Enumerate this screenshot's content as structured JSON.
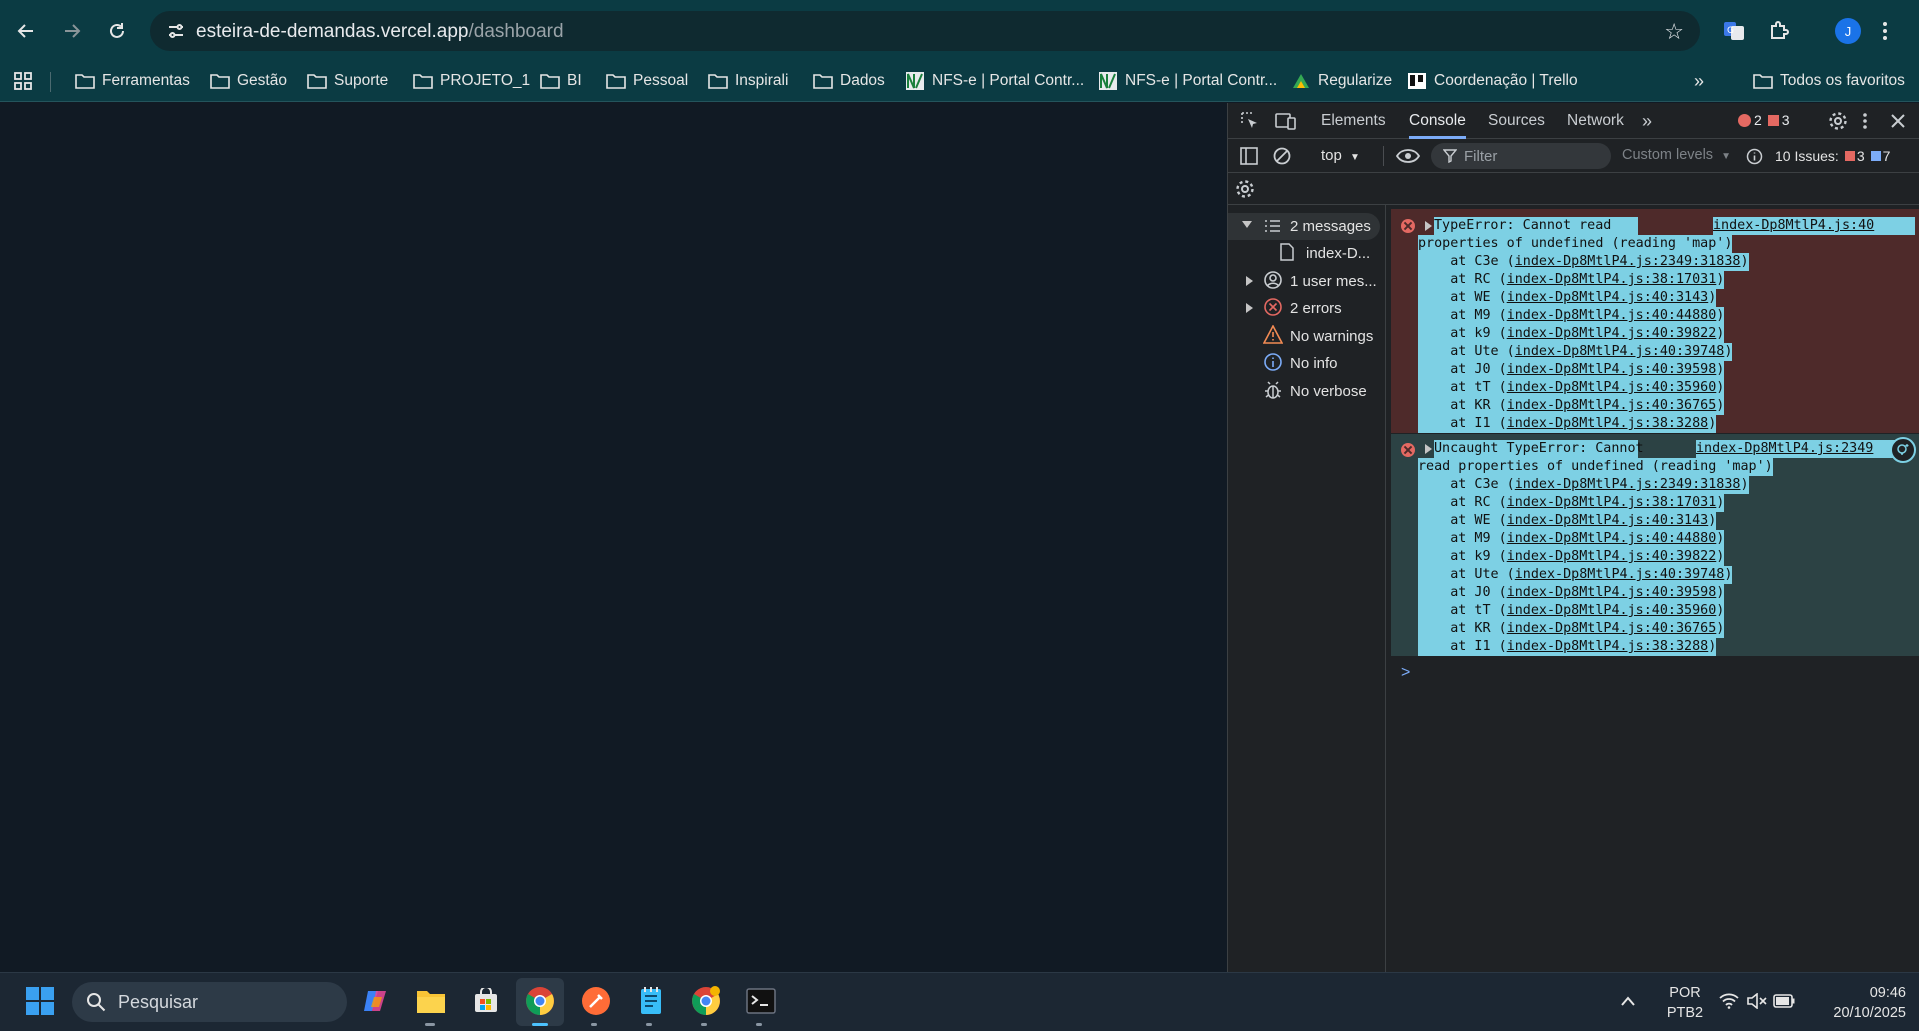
{
  "browser": {
    "url_host": "esteira-de-demandas.vercel.app",
    "url_path": "/dashboard",
    "profile_initial": "J"
  },
  "bookmarks": {
    "items": [
      {
        "label": "Ferramentas",
        "icon": "folder-icon"
      },
      {
        "label": "Gestão",
        "icon": "folder-icon"
      },
      {
        "label": "Suporte",
        "icon": "folder-icon"
      },
      {
        "label": "PROJETO_1",
        "icon": "folder-icon"
      },
      {
        "label": "BI",
        "icon": "folder-icon"
      },
      {
        "label": "Pessoal",
        "icon": "folder-icon"
      },
      {
        "label": "Inspirali",
        "icon": "folder-icon"
      },
      {
        "label": "Dados",
        "icon": "folder-icon"
      },
      {
        "label": "NFS-e | Portal Contr...",
        "icon": "nfse-icon"
      },
      {
        "label": "NFS-e | Portal Contr...",
        "icon": "nfse-icon"
      },
      {
        "label": "Regularize",
        "icon": "regularize-icon"
      },
      {
        "label": "Coordenação | Trello",
        "icon": "trello-icon"
      }
    ],
    "more": "»",
    "all_bookmarks": "Todos os favoritos"
  },
  "devtools": {
    "tabs": [
      "Elements",
      "Console",
      "Sources",
      "Network"
    ],
    "active_tab": "Console",
    "error_count": "2",
    "issue_count": "3",
    "context": "top",
    "filter_placeholder": "Filter",
    "levels": "Custom levels",
    "issues_label": "10 Issues:",
    "issues_errors": "3",
    "issues_info": "7",
    "sidebar": {
      "messages": "2 messages",
      "file": "index-D...",
      "user_messages": "1 user mes...",
      "errors": "2 errors",
      "warnings": "No warnings",
      "info": "No info",
      "verbose": "No verbose"
    },
    "errors": [
      {
        "line1": "TypeError: Cannot read",
        "source": "index-Dp8MtlP4.js:40",
        "line2": "properties of undefined (reading 'map')",
        "stack": [
          {
            "fn": "C3e",
            "loc": "index-Dp8MtlP4.js:2349:31838"
          },
          {
            "fn": "RC",
            "loc": "index-Dp8MtlP4.js:38:17031"
          },
          {
            "fn": "WE",
            "loc": "index-Dp8MtlP4.js:40:3143"
          },
          {
            "fn": "M9",
            "loc": "index-Dp8MtlP4.js:40:44880"
          },
          {
            "fn": "k9",
            "loc": "index-Dp8MtlP4.js:40:39822"
          },
          {
            "fn": "Ute",
            "loc": "index-Dp8MtlP4.js:40:39748"
          },
          {
            "fn": "J0",
            "loc": "index-Dp8MtlP4.js:40:39598"
          },
          {
            "fn": "tT",
            "loc": "index-Dp8MtlP4.js:40:35960"
          },
          {
            "fn": "KR",
            "loc": "index-Dp8MtlP4.js:40:36765"
          },
          {
            "fn": "I1",
            "loc": "index-Dp8MtlP4.js:38:3288"
          }
        ]
      },
      {
        "line1": "Uncaught TypeError: Cannot",
        "source": "index-Dp8MtlP4.js:2349",
        "line2": "read properties of undefined (reading 'map')",
        "stack": [
          {
            "fn": "C3e",
            "loc": "index-Dp8MtlP4.js:2349:31838"
          },
          {
            "fn": "RC",
            "loc": "index-Dp8MtlP4.js:38:17031"
          },
          {
            "fn": "WE",
            "loc": "index-Dp8MtlP4.js:40:3143"
          },
          {
            "fn": "M9",
            "loc": "index-Dp8MtlP4.js:40:44880"
          },
          {
            "fn": "k9",
            "loc": "index-Dp8MtlP4.js:40:39822"
          },
          {
            "fn": "Ute",
            "loc": "index-Dp8MtlP4.js:40:39748"
          },
          {
            "fn": "J0",
            "loc": "index-Dp8MtlP4.js:40:39598"
          },
          {
            "fn": "tT",
            "loc": "index-Dp8MtlP4.js:40:35960"
          },
          {
            "fn": "KR",
            "loc": "index-Dp8MtlP4.js:40:36765"
          },
          {
            "fn": "I1",
            "loc": "index-Dp8MtlP4.js:38:3288"
          }
        ]
      }
    ],
    "prompt": ">"
  },
  "taskbar": {
    "search_placeholder": "Pesquisar",
    "lang_1": "POR",
    "lang_2": "PTB2",
    "time": "09:46",
    "date": "20/10/2025"
  },
  "colors": {
    "browser_chrome": "#0b3b43",
    "page_bg": "#111a24",
    "devtools_bg": "#1f2225",
    "error_bg": "#4e2a2a",
    "selection": "#7dd0e4",
    "error_red": "#e46962"
  }
}
